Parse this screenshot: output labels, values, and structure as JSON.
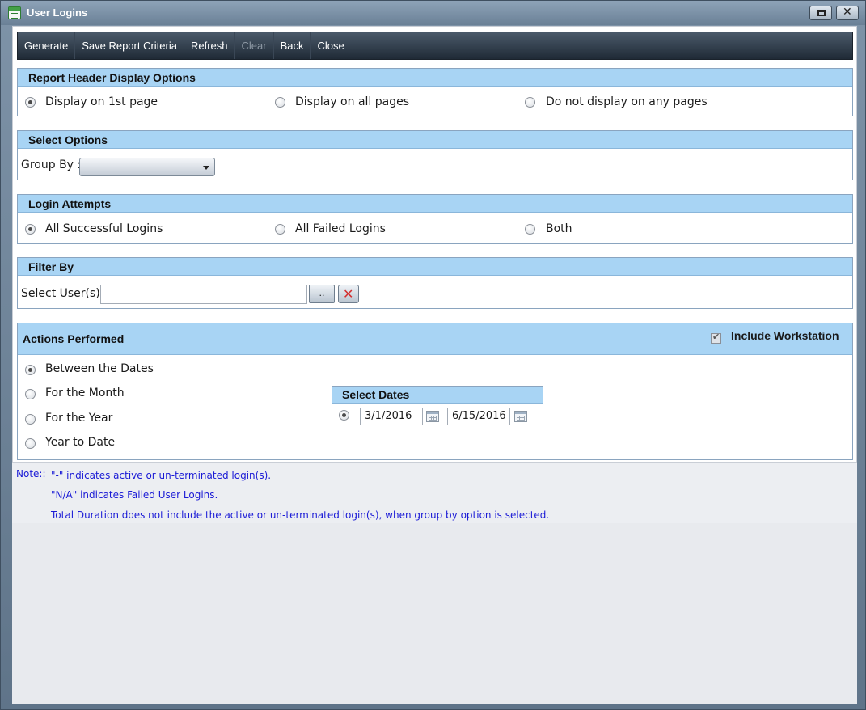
{
  "window": {
    "title": "User Logins"
  },
  "toolbar": {
    "generate": "Generate",
    "save_report_criteria": "Save Report Criteria",
    "refresh": "Refresh",
    "clear": "Clear",
    "back": "Back",
    "close": "Close"
  },
  "report_header": {
    "title": "Report Header Display Options",
    "options": [
      "Display on 1st page",
      "Display on all pages",
      "Do not display on any pages"
    ],
    "selected_index": 0
  },
  "select_options": {
    "title": "Select Options",
    "group_by_label": "Group By :",
    "group_by_value": ""
  },
  "login_attempts": {
    "title": "Login Attempts",
    "options": [
      "All Successful Logins",
      "All Failed Logins",
      "Both"
    ],
    "selected_index": 0
  },
  "filter_by": {
    "title": "Filter By",
    "select_users_label": "Select User(s) :",
    "select_users_value": "",
    "browse_label": ".."
  },
  "actions_performed": {
    "title": "Actions Performed",
    "include_workstation_label": "Include Workstation",
    "include_workstation_checked": true,
    "options": [
      "Between the Dates",
      "For the Month",
      "For the Year",
      "Year to Date"
    ],
    "selected_index": 0,
    "select_dates": {
      "title": "Select Dates",
      "from_date": "3/1/2016",
      "to_date": "6/15/2016"
    }
  },
  "notes": {
    "label": "Note::",
    "lines": [
      "\"-\" indicates active or un-terminated login(s).",
      "\"N/A\" indicates Failed User Logins.",
      "Total Duration does not include the active or un-terminated login(s), when group by option is selected."
    ]
  },
  "colors": {
    "section_header": "#a8d4f4",
    "toolbar": "#2b3744",
    "note_text": "#1a1ad6"
  }
}
